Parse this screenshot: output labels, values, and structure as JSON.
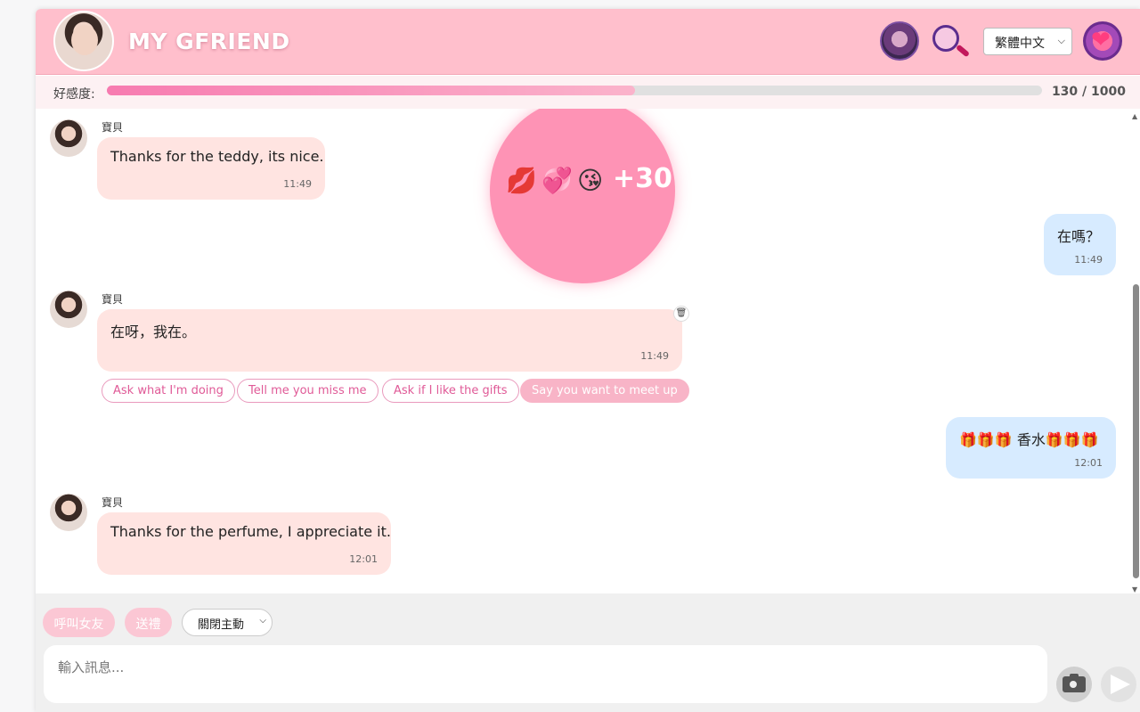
{
  "header": {
    "title": "MY GFRIEND",
    "language": "繁體中文",
    "icons": [
      "girlfriend-gallery-icon",
      "search-profile-icon",
      "heart-settings-icon"
    ]
  },
  "affection": {
    "label": "好感度:",
    "current": 130,
    "max": 1000,
    "value_text": "130 / 1000",
    "fill_fraction": 0.13,
    "bar_color": "#f77bb0"
  },
  "reward": {
    "emojis": [
      "💋",
      "💞",
      "😘"
    ],
    "points": "+30",
    "color": "#fe93b5"
  },
  "messages": [
    {
      "from": "her",
      "sender": "寶貝",
      "text": "Thanks for the teddy, its nice.",
      "time": "11:49"
    },
    {
      "from": "me",
      "text": "在嗎？",
      "time": "11:49"
    },
    {
      "from": "her",
      "sender": "寶貝",
      "text": "在呀，我在。",
      "time": "11:49"
    },
    {
      "from": "me",
      "text": "🎁🎁🎁 香水🎁🎁🎁",
      "time": "12:01"
    },
    {
      "from": "her",
      "sender": "寶貝",
      "text": "Thanks for the perfume, I appreciate it.",
      "time": "12:01"
    }
  ],
  "suggestions": [
    "Ask what I'm doing",
    "Tell me you miss me",
    "Ask if I like the gifts",
    "Say you want to meet up"
  ],
  "footer": {
    "call_button": "呼叫女友",
    "gift_button": "送禮",
    "proactive_select": "關閉主動",
    "input_placeholder": "輸入訊息..."
  },
  "colors": {
    "header_bg": "#ffbfcc",
    "her_bubble": "#ffe4e1",
    "my_bubble": "#d7ebff",
    "accent": "#e05a97"
  }
}
